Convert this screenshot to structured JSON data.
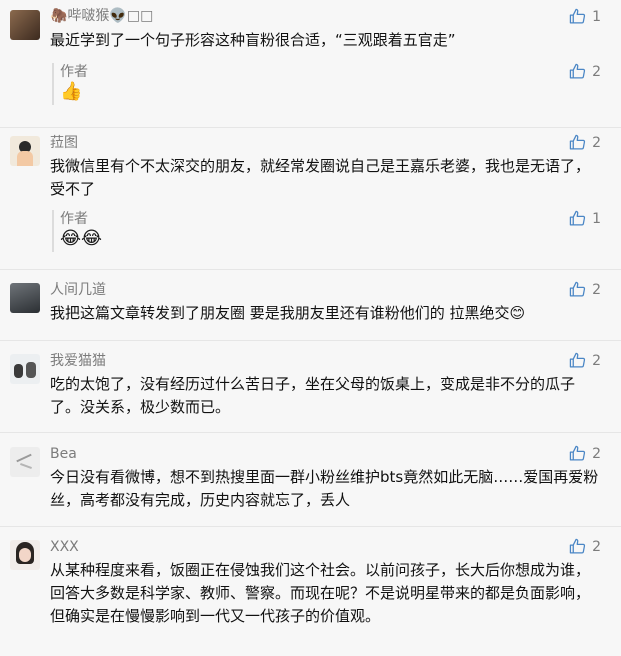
{
  "comments": [
    {
      "name": "🦣哔啵猴👽□□",
      "text": "最近学到了一个句子形容这种盲粉很合适，“三观跟着五官走”",
      "likes": "1",
      "reply": {
        "author": "作者",
        "emoji": "👍",
        "likes": "2"
      }
    },
    {
      "name": "菈图",
      "text": "我微信里有个不太深交的朋友，就经常发圈说自己是王嘉乐老婆，我也是无语了，受不了",
      "likes": "2",
      "reply": {
        "author": "作者",
        "emoji": "😂😂",
        "likes": "1"
      }
    },
    {
      "name": "人间几道",
      "text": "我把这篇文章转发到了朋友圈 要是我朋友里还有谁粉他们的 拉黑绝交😊",
      "likes": "2"
    },
    {
      "name": "我爱猫猫",
      "text": "吃的太饱了，没有经历过什么苦日子，坐在父母的饭桌上，变成是非不分的瓜子了。没关系，极少数而已。",
      "likes": "2"
    },
    {
      "name": "Bea",
      "text": "今日没有看微博，想不到热搜里面一群小粉丝维护bts竟然如此无脑……爱国再爱粉丝，高考都没有完成，历史内容就忘了，丢人",
      "likes": "2"
    },
    {
      "name": "XXX",
      "text": "从某种程度来看，饭圈正在侵蚀我们这个社会。以前问孩子，长大后你想成为谁，回答大多数是科学家、教师、警察。而现在呢？不是说明星带来的都是负面影响，但确实是在慢慢影响到一代又一代孩子的价值观。",
      "likes": "2"
    }
  ]
}
